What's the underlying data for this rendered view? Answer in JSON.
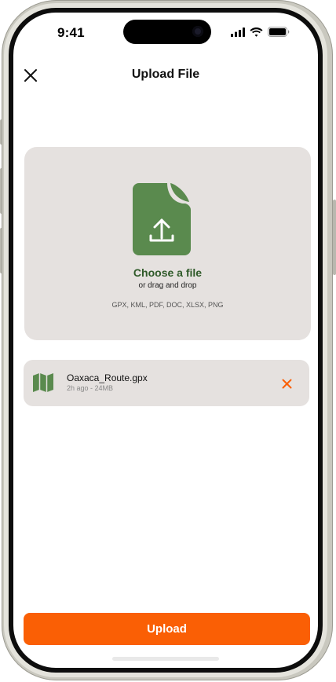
{
  "status_bar": {
    "time": "9:41"
  },
  "header": {
    "title": "Upload File",
    "close_icon": "close-icon"
  },
  "dropzone": {
    "icon": "file-upload-icon",
    "choose_label": "Choose a file",
    "drag_label": "or drag and drop",
    "formats": "GPX, KML, PDF, DOC, XLSX, PNG"
  },
  "file_item": {
    "icon": "map-icon",
    "name": "Oaxaca_Route.gpx",
    "meta": "2h ago - 24MB",
    "remove_icon": "close-icon"
  },
  "upload_button": {
    "label": "Upload"
  },
  "colors": {
    "accent": "#fa5f05",
    "brand_green": "#5a8a4e",
    "panel_bg": "#e5e1df",
    "choose_text": "#2f5a29"
  }
}
